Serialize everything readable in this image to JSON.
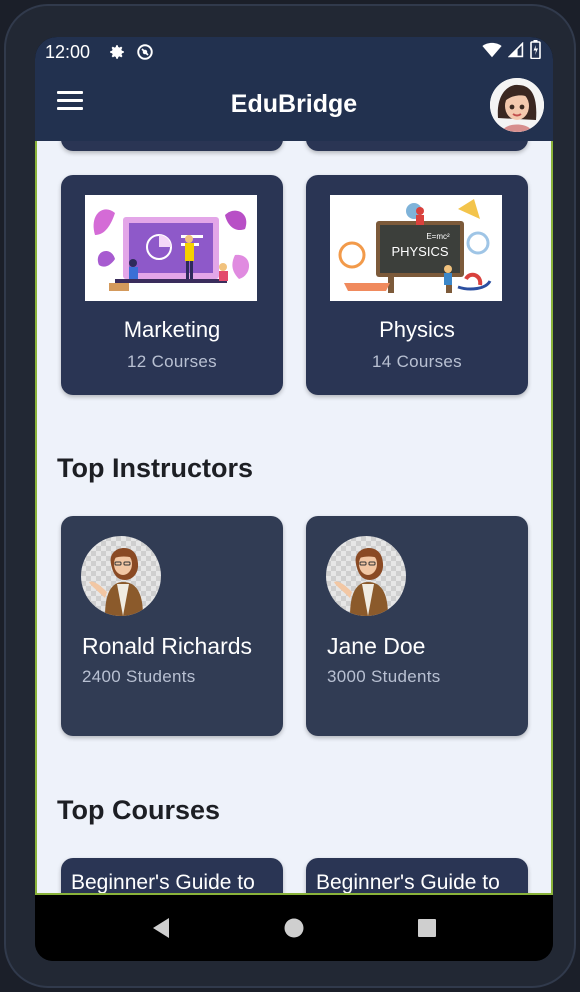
{
  "status_bar": {
    "time": "12:00"
  },
  "app_bar": {
    "title": "EduBridge"
  },
  "categories": [
    {
      "title": "Marketing",
      "subtitle": "12 Courses"
    },
    {
      "title": "Physics",
      "subtitle": "14 Courses",
      "image_text": "PHYSICS",
      "formula": "E=mc²"
    }
  ],
  "instructors_section": {
    "title": "Top Instructors"
  },
  "instructors": [
    {
      "name": "Ronald Richards",
      "students": "2400 Students"
    },
    {
      "name": "Jane Doe",
      "students": "3000 Students"
    }
  ],
  "courses_section": {
    "title": "Top Courses"
  },
  "courses": [
    {
      "title": "Beginner's Guide to"
    },
    {
      "title": "Beginner's Guide to"
    }
  ],
  "colors": {
    "app_bar": "#22314f",
    "card": "#2a3554",
    "instructor_card": "#313c54",
    "background": "#eef2fa"
  }
}
